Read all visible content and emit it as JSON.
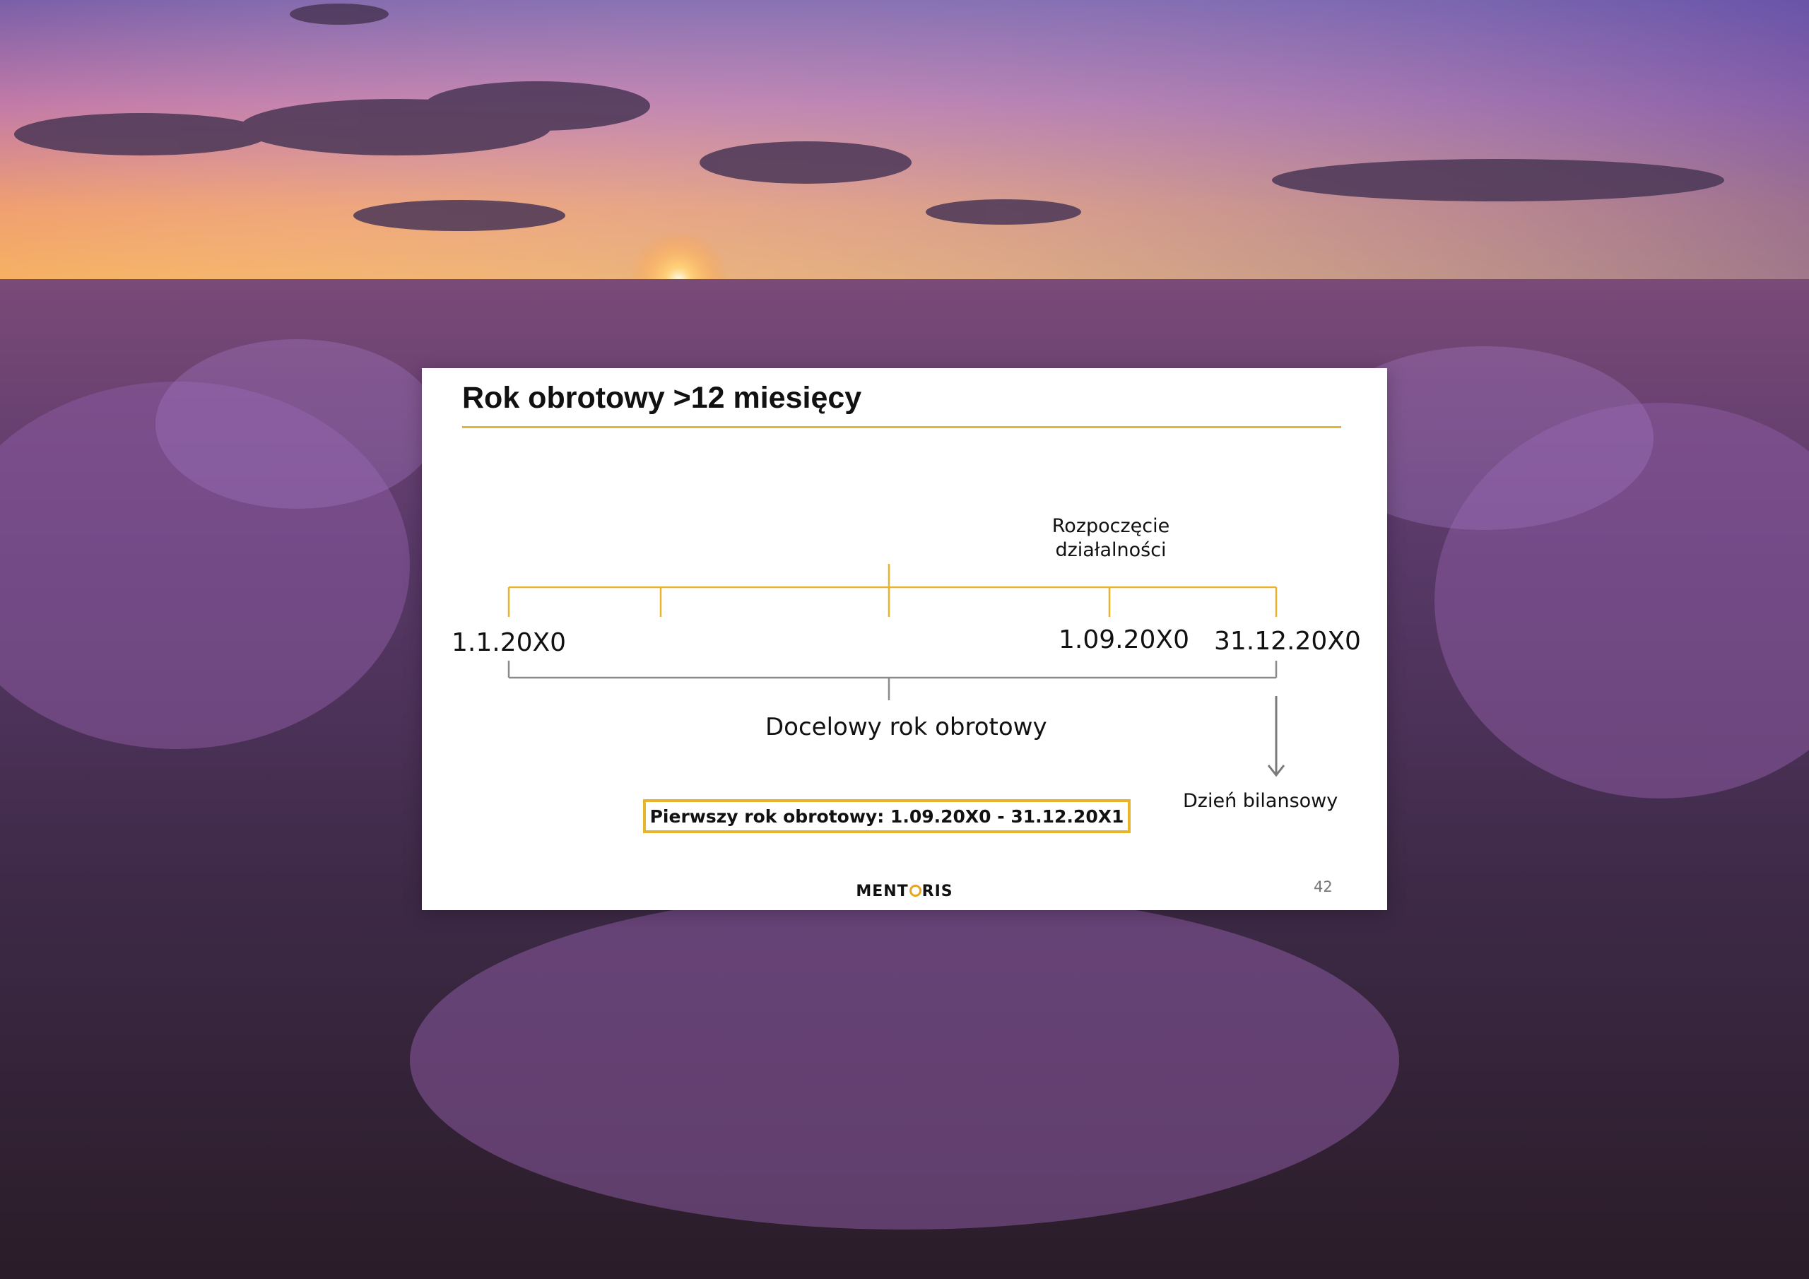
{
  "slide": {
    "title": "Rok obrotowy >12 miesięcy",
    "page_number": "42",
    "brand": {
      "before": "MENT",
      "after": "RIS"
    },
    "accent_color": "#e8b52a"
  },
  "timeline": {
    "start_date": "1.1.20X0",
    "activity_start_label": "Rozpoczęcie\ndziałalności",
    "activity_start_date": "1.09.20X0",
    "end_date": "31.12.20X0",
    "target_year_label": "Docelowy rok obrotowy",
    "balance_day_label": "Dzień bilansowy",
    "first_year_callout": "Pierwszy rok obrotowy: 1.09.20X0 - 31.12.20X1"
  }
}
